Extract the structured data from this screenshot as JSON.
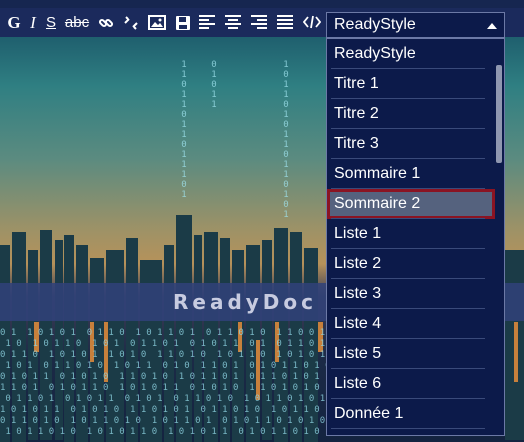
{
  "toolbar": {
    "bold": "G",
    "italic": "I",
    "underline": "S",
    "strike": "abc",
    "icons": [
      "link-icon",
      "unlink-icon",
      "image-icon",
      "save-icon",
      "align-left-icon",
      "align-center-icon",
      "align-right-icon",
      "align-justify-icon",
      "code-icon"
    ]
  },
  "style_select": {
    "value": "ReadyStyle",
    "options": [
      "ReadyStyle",
      "Titre 1",
      "Titre 2",
      "Titre 3",
      "Sommaire 1",
      "Sommaire 2",
      "Liste 1",
      "Liste 2",
      "Liste 3",
      "Liste 4",
      "Liste 5",
      "Liste 6",
      "Donnée 1"
    ],
    "highlighted_index": 5
  },
  "banner": {
    "title": "ReadyDoc"
  },
  "colors": {
    "toolbar": "#1b2a5c",
    "dropdown_bg": "#0c1a4a",
    "highlight_border": "#8a1423",
    "highlight_bg": "#55627e"
  }
}
